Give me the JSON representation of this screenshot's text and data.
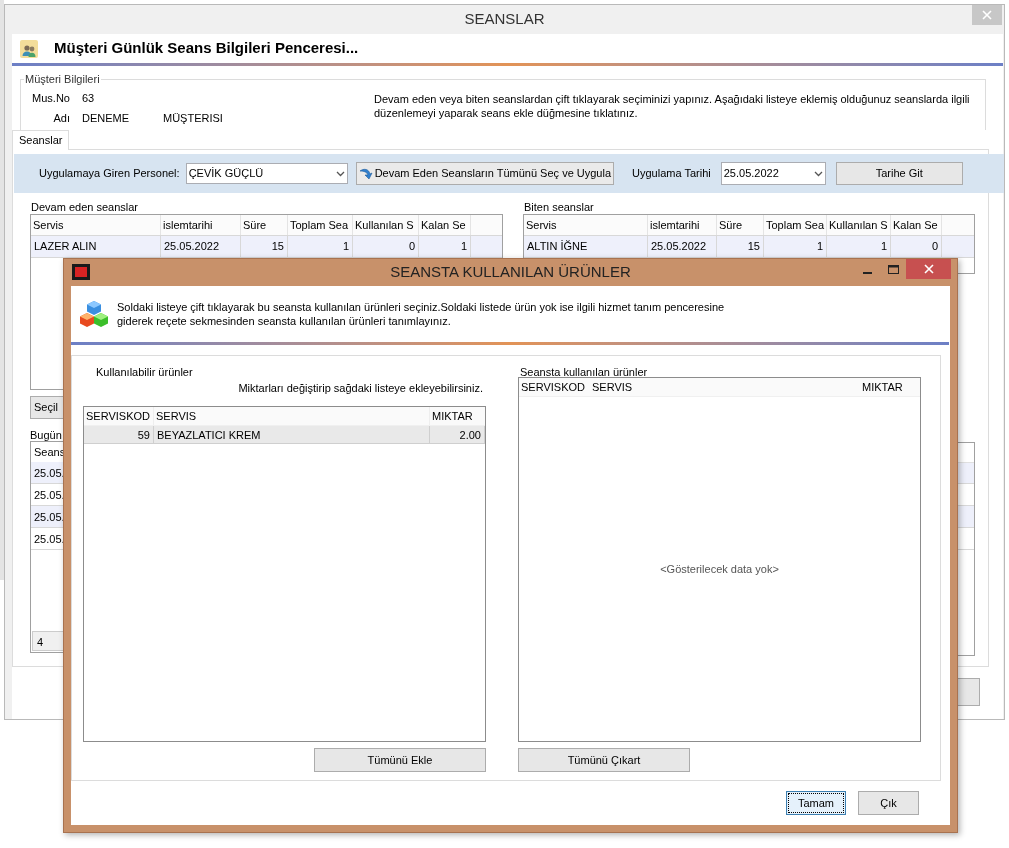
{
  "background_window": {
    "title": "SEANSLAR",
    "header_title": "Müşteri Günlük Seans Bilgileri Penceresi...",
    "customer_info": {
      "legend": "Müşteri Bilgileri",
      "fields": [
        {
          "label": "Mus.No",
          "values": [
            "63"
          ]
        },
        {
          "label": "Adı",
          "values": [
            "DENEME",
            "MÜŞTERISI"
          ]
        }
      ],
      "instructions": "Devam eden veya biten seanslardan çift tıklayarak seçiminizi yapınız. Aşağıdaki listeye eklemiş olduğunuz seanslarda ilgili düzenlemeyi yaparak seans ekle düğmesine tıklatınız."
    },
    "tabs": [
      {
        "label": "Seanslar",
        "selected": true
      }
    ],
    "toolbar": {
      "staff_label": "Uygulamaya Giren Personel:",
      "staff_value": "ÇEVİK GÜÇLÜ",
      "apply_all_button": "Devam Eden Seansların Tümünü Seç ve Uygula",
      "date_label": "Uygulama Tarihi",
      "date_value": "25.05.2022",
      "goto_button": "Tarihe Git"
    },
    "ongoing": {
      "title": "Devam eden seanslar",
      "columns": [
        "Servis",
        "islemtarihi",
        "Süre",
        "Toplam Sea",
        "Kullanılan S",
        "Kalan Se"
      ],
      "rows": [
        {
          "cells": [
            "LAZER ALIN",
            "25.05.2022",
            "15",
            "1",
            "0",
            "1"
          ],
          "selected": true
        }
      ]
    },
    "finished": {
      "title": "Biten seanslar",
      "columns": [
        "Servis",
        "islemtarihi",
        "Süre",
        "Toplam Sea",
        "Kullanılan S",
        "Kalan Se"
      ],
      "rows": [
        {
          "cells": [
            "ALTIN İĞNE",
            "25.05.2022",
            "15",
            "1",
            "1",
            "0"
          ],
          "selected": true
        }
      ]
    },
    "selected_button": "Seçil",
    "today": {
      "title": "Bugün",
      "header": "Seans",
      "rows": [
        "25.05.",
        "25.05.",
        "25.05.",
        "25.05."
      ],
      "footer": "4"
    }
  },
  "dialog": {
    "title": "SEANSTA KULLANILAN ÜRÜNLER",
    "instructions": [
      "Soldaki listeye çift tıklayarak bu seansta kullanılan ürünleri seçiniz.Soldaki listede ürün yok ise ilgili hizmet tanım penceresine",
      "giderek reçete sekmesinden seansta kullanılan ürünleri tanımlayınız."
    ],
    "available": {
      "title": "Kullanılabilir ürünler",
      "hint": "Miktarları değiştirip sağdaki listeye ekleyebilirsiniz.",
      "columns": [
        "SERVISKOD",
        "SERVIS",
        "MIKTAR"
      ],
      "rows": [
        {
          "cells": [
            "59",
            "BEYAZLATICI KREM",
            "2.00"
          ],
          "selected": true
        }
      ],
      "button": "Tümünü Ekle"
    },
    "used": {
      "title": "Seansta kullanılan ürünler",
      "columns": [
        "SERVISKOD",
        "SERVIS",
        "MIKTAR"
      ],
      "empty_text": "<Gösterilecek data yok>",
      "button": "Tümünü Çıkart"
    },
    "buttons": [
      {
        "label": "Tamam",
        "focused": true
      },
      {
        "label": "Çık",
        "focused": false
      }
    ]
  }
}
